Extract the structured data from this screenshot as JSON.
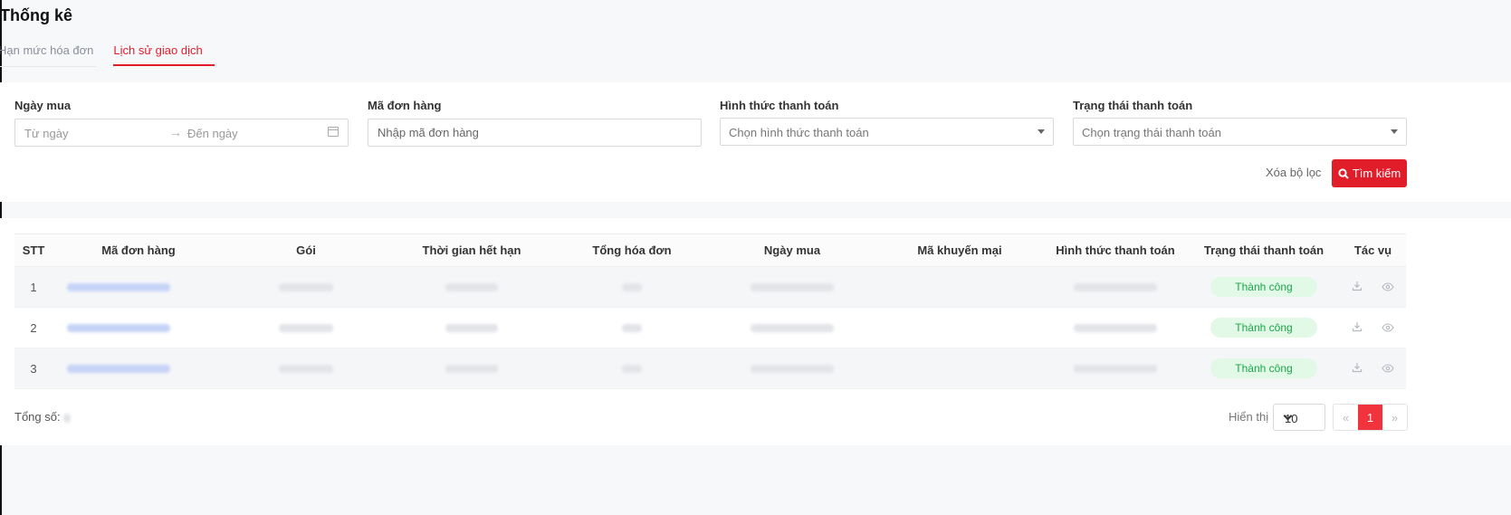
{
  "page": {
    "title": "Thống kê"
  },
  "tabs": [
    {
      "label": "Hạn mức hóa đơn",
      "active": false
    },
    {
      "label": "Lịch sử giao dịch",
      "active": true
    }
  ],
  "filters": {
    "purchase_date": {
      "label": "Ngày mua",
      "from_placeholder": "Từ ngày",
      "to_placeholder": "Đến ngày"
    },
    "order_code": {
      "label": "Mã đơn hàng",
      "placeholder": "Nhập mã đơn hàng"
    },
    "payment_method": {
      "label": "Hình thức thanh toán",
      "placeholder": "Chọn hình thức thanh toán"
    },
    "payment_status": {
      "label": "Trạng thái thanh toán",
      "placeholder": "Chọn trạng thái thanh toán"
    },
    "clear_label": "Xóa bộ lọc",
    "search_label": "Tìm kiếm"
  },
  "table": {
    "columns": [
      "STT",
      "Mã đơn hàng",
      "Gói",
      "Thời gian hết hạn",
      "Tổng hóa đơn",
      "Ngày mua",
      "Mã khuyến mại",
      "Hình thức thanh toán",
      "Trạng thái thanh toán",
      "Tác vụ"
    ],
    "rows": [
      {
        "stt": "1",
        "status": "Thành công"
      },
      {
        "stt": "2",
        "status": "Thành công"
      },
      {
        "stt": "3",
        "status": "Thành công"
      }
    ]
  },
  "footer": {
    "total_label": "Tổng số:",
    "show_label": "Hiển thị",
    "page_size": "10",
    "pagination": {
      "prev": "«",
      "current": "1",
      "next": "»"
    }
  },
  "colors": {
    "accent": "#e11d2a",
    "success_bg": "#e2f9e7",
    "success_text": "#1aa64a"
  }
}
